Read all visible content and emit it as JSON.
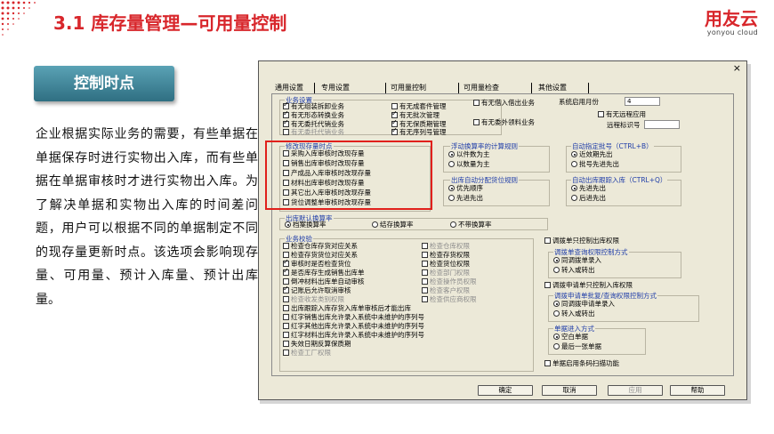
{
  "slide": {
    "title": "3.1 库存量管理—可用量控制",
    "logo": {
      "cn": "用友云",
      "en": "yonyou cloud"
    },
    "section_label": "控制时点",
    "paragraph": "企业根据实际业务的需要，有些单据在单据保存时进行实物出入库，而有些单据在单据审核时才进行实物出入库。为了解决单据和实物出入库的时间差问题，用户可以根据不同的单据制定不同的现存量更新时点。该选项会影响现存量、可用量、预计入库量、预计出库量。",
    "accent_color": "#d8262b"
  },
  "dialog": {
    "close_label": "×",
    "tabs": [
      "通用设置",
      "专用设置",
      "可用量控制",
      "可用量检查",
      "其他设置"
    ],
    "business_settings": {
      "title": "业务设置",
      "col1": [
        {
          "label": "有无组装拆卸业务",
          "checked": true
        },
        {
          "label": "有无形态转换业务",
          "checked": true
        },
        {
          "label": "有无委托代销业务",
          "checked": true
        },
        {
          "label": "有无委托代销业务",
          "checked": false
        }
      ],
      "col2": [
        {
          "label": "有无成套件管理",
          "checked": false
        },
        {
          "label": "有无批次管理",
          "checked": true
        },
        {
          "label": "有无保质期管理",
          "checked": true
        },
        {
          "label": "有无序列号管理",
          "checked": true
        }
      ],
      "col3": [
        {
          "label": "有无借入借出业务",
          "checked": false
        },
        {
          "label": "有无委外领料业务",
          "checked": false
        }
      ],
      "start_month_label": "系统启用月份",
      "start_month_value": "4",
      "remote_app_label": "有无远程应用",
      "remote_app_checked": false,
      "remote_id_label": "远程标识号",
      "remote_id_value": ""
    },
    "update_timing": {
      "title": "修改现存量时点",
      "items": [
        {
          "label": "采购入库审核时改现存量",
          "checked": false
        },
        {
          "label": "销售出库审核时改现存量",
          "checked": false
        },
        {
          "label": "产成品入库审核时改现存量",
          "checked": false
        },
        {
          "label": "材料出库审核时改现存量",
          "checked": false
        },
        {
          "label": "其它出入库审核时改现存量",
          "checked": false
        },
        {
          "label": "货位调整单审核时改现存量",
          "checked": false
        }
      ]
    },
    "floating_rule": {
      "title": "浮动换算率的计算规则",
      "options": [
        {
          "label": "以件数为主",
          "selected": true
        },
        {
          "label": "以数量为主",
          "selected": false
        }
      ]
    },
    "auto_batch": {
      "title": "自动指定批号（CTRL+B）",
      "options": [
        {
          "label": "近效期先出",
          "selected": true
        },
        {
          "label": "批号先进先出",
          "selected": false
        }
      ]
    },
    "auto_location": {
      "title": "出库自动分配货位规则",
      "options": [
        {
          "label": "优先顺序",
          "selected": true
        },
        {
          "label": "先进先出",
          "selected": false
        }
      ]
    },
    "auto_trace": {
      "title": "自动出库跟踪入库（CTRL+Q）",
      "options": [
        {
          "label": "先进先出",
          "selected": true
        },
        {
          "label": "后进先出",
          "selected": false
        }
      ]
    },
    "default_conversion": {
      "title": "出库默认换算率",
      "options": [
        {
          "label": "档案换算率",
          "selected": true
        },
        {
          "label": "结存换算率",
          "selected": false
        },
        {
          "label": "不带换算率",
          "selected": false
        }
      ]
    },
    "business_check": {
      "title": "业务校验",
      "col1": [
        {
          "label": "检查仓库存货对应关系",
          "checked": false,
          "disabled": false
        },
        {
          "label": "检查存货货位对应关系",
          "checked": false,
          "disabled": false
        },
        {
          "label": "审核时是否检查货位",
          "checked": true,
          "disabled": false
        },
        {
          "label": "是否库存生成销售出库单",
          "checked": true,
          "disabled": false
        },
        {
          "label": "倒冲材料出库单自动审核",
          "checked": false,
          "disabled": false
        },
        {
          "label": "记账后允许取消审核",
          "checked": true,
          "disabled": false
        },
        {
          "label": "检查收发类别权限",
          "checked": false,
          "disabled": true
        },
        {
          "label": "出库跟踪入库存货入库单审核后才能出库",
          "checked": false,
          "disabled": false
        },
        {
          "label": "红字销售出库允许录入系统中未维护的序列号",
          "checked": false,
          "disabled": false
        },
        {
          "label": "红字其他出库允许录入系统中未维护的序列号",
          "checked": false,
          "disabled": false
        },
        {
          "label": "红字材料出库允许录入系统中未维护的序列号",
          "checked": false,
          "disabled": false
        },
        {
          "label": "失效日期反算保质期",
          "checked": false,
          "disabled": false
        },
        {
          "label": "检查工厂权限",
          "checked": false,
          "disabled": true
        }
      ],
      "col2": [
        {
          "label": "检查仓库权限",
          "checked": false,
          "disabled": true
        },
        {
          "label": "检查存货权限",
          "checked": false,
          "disabled": false
        },
        {
          "label": "检查货位权限",
          "checked": false,
          "disabled": false
        },
        {
          "label": "检查部门权限",
          "checked": false,
          "disabled": true
        },
        {
          "label": "检查操作员权限",
          "checked": false,
          "disabled": true
        },
        {
          "label": "检查客户权限",
          "checked": false,
          "disabled": true
        },
        {
          "label": "检查供应商权限",
          "checked": false,
          "disabled": true
        }
      ]
    },
    "right_options": {
      "transfer_ctrl_label": "调拨单只控制出库权限",
      "transfer_ctrl_checked": false,
      "transfer_query": {
        "title": "调拨单查询权限控制方式",
        "options": [
          {
            "label": "同调拨单录入",
            "selected": true
          },
          {
            "label": "转入或转出",
            "selected": false
          }
        ]
      },
      "transfer_req_ctrl_label": "调拨申请单只控制入库权限",
      "transfer_req_ctrl_checked": false,
      "transfer_req": {
        "title": "调拨申请单批复/查询权限控制方式",
        "options": [
          {
            "label": "同调拨申请单录入",
            "selected": true
          },
          {
            "label": "转入或转出",
            "selected": false
          }
        ]
      },
      "doc_entry": {
        "title": "单据进入方式",
        "options": [
          {
            "label": "空白单据",
            "selected": true
          },
          {
            "label": "最后一张单据",
            "selected": false
          }
        ]
      },
      "barcode_label": "单据启用条码扫描功能",
      "barcode_checked": false
    },
    "buttons": {
      "ok": "确定",
      "cancel": "取消",
      "apply": "应用",
      "help": "帮助"
    }
  }
}
